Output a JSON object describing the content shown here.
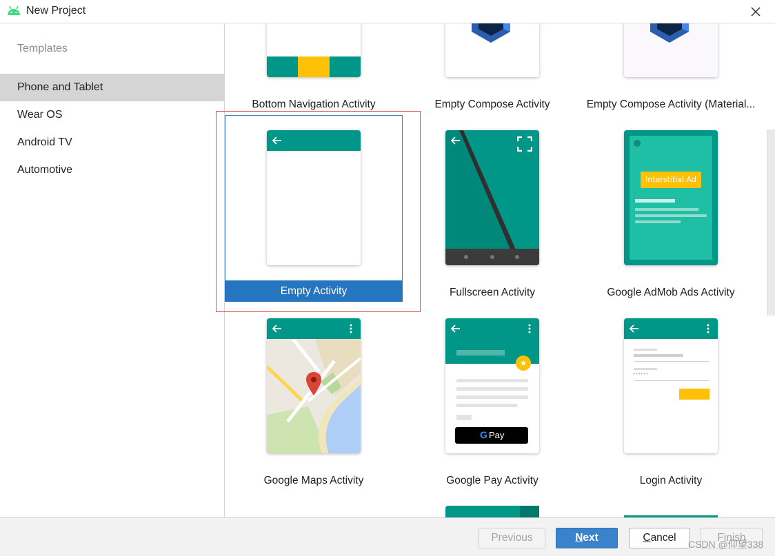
{
  "window": {
    "title": "New Project"
  },
  "colors": {
    "accent": "#2675c0",
    "teal": "#009688",
    "amber": "#FFC107",
    "selection_outline": "#d9534f"
  },
  "sidebar": {
    "heading": "Templates",
    "items": [
      {
        "label": "Phone and Tablet",
        "selected": true
      },
      {
        "label": "Wear OS",
        "selected": false
      },
      {
        "label": "Android TV",
        "selected": false
      },
      {
        "label": "Automotive",
        "selected": false
      }
    ]
  },
  "templates": [
    {
      "label": "Bottom Navigation Activity"
    },
    {
      "label": "Empty Compose Activity"
    },
    {
      "label": "Empty Compose Activity (Material..."
    },
    {
      "label": "Empty Activity",
      "selected": true
    },
    {
      "label": "Fullscreen Activity"
    },
    {
      "label": "Google AdMob Ads Activity",
      "ad_badge": "Interstitial Ad"
    },
    {
      "label": "Google Maps Activity"
    },
    {
      "label": "Google Pay Activity",
      "pay_button": "Pay"
    },
    {
      "label": "Login Activity",
      "password_mask": "••••••"
    }
  ],
  "footer": {
    "previous": "Previous",
    "next_mnemonic": "N",
    "next_rest": "ext",
    "cancel_mnemonic": "C",
    "cancel_rest": "ancel",
    "finish": "Finish"
  },
  "watermark": "CSDN @仰望338"
}
